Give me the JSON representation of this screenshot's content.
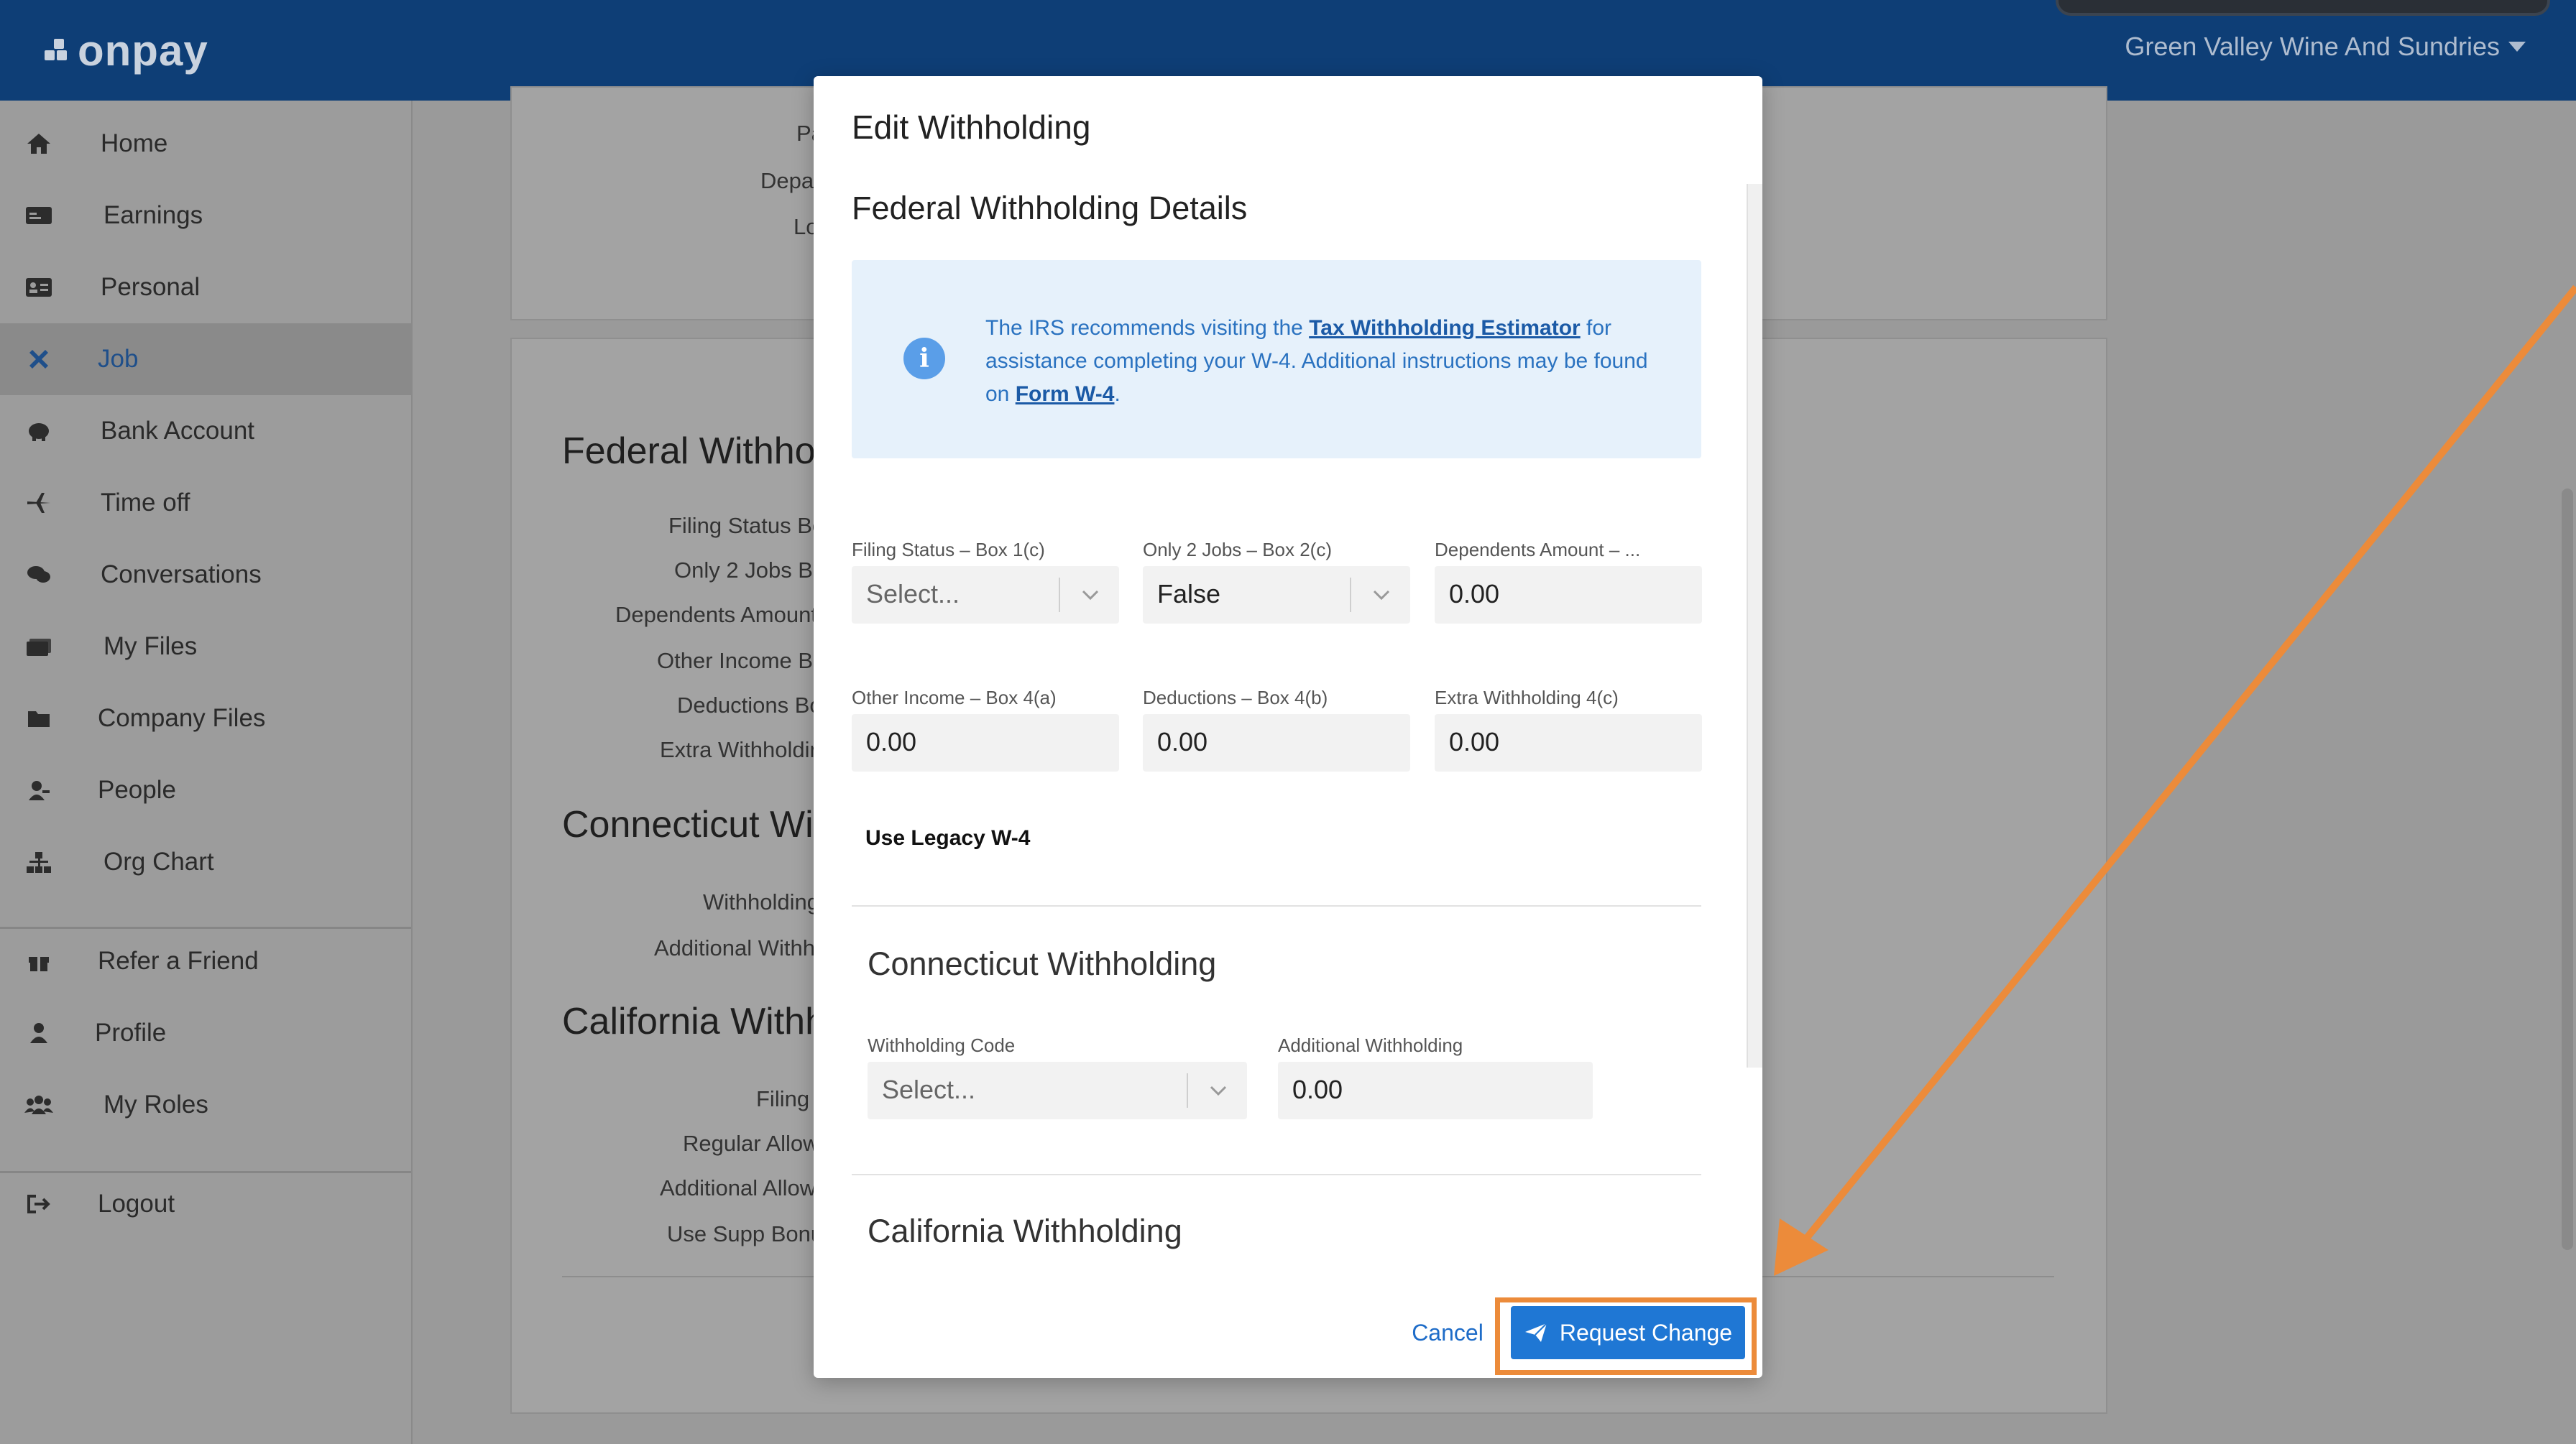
{
  "app": {
    "logo_text": "onpay",
    "company_name": "Green Valley Wine And Sundries"
  },
  "sidebar": {
    "items": [
      {
        "label": "Home",
        "icon": "home-icon"
      },
      {
        "label": "Earnings",
        "icon": "money-icon"
      },
      {
        "label": "Personal",
        "icon": "id-card-icon"
      },
      {
        "label": "Job",
        "icon": "tools-icon",
        "active": true
      },
      {
        "label": "Bank Account",
        "icon": "piggy-bank-icon"
      },
      {
        "label": "Time off",
        "icon": "plane-icon"
      },
      {
        "label": "Conversations",
        "icon": "chat-icon"
      },
      {
        "label": "My Files",
        "icon": "files-icon"
      },
      {
        "label": "Company Files",
        "icon": "folder-icon"
      },
      {
        "label": "People",
        "icon": "people-icon"
      },
      {
        "label": "Org Chart",
        "icon": "org-chart-icon"
      },
      {
        "label": "Refer a Friend",
        "icon": "gift-icon"
      },
      {
        "label": "Profile",
        "icon": "user-icon"
      },
      {
        "label": "My Roles",
        "icon": "group-icon"
      },
      {
        "label": "Logout",
        "icon": "logout-icon"
      }
    ]
  },
  "background": {
    "top_card_labels": [
      "Pa",
      "Depa",
      "Lo"
    ],
    "federal_heading": "Federal Withho",
    "federal_labels": [
      "Filing Status Bo",
      "Only 2 Jobs Bo",
      "Dependents Amount",
      "Other Income Bo",
      "Deductions Bo",
      "Extra Withholdin"
    ],
    "ct_heading": "Connecticut Wi",
    "ct_labels": [
      "Withholding",
      "Additional Withh"
    ],
    "ca_heading": "California Withh",
    "ca_labels": [
      "Filing",
      "Regular Allow",
      "Additional Allow",
      "Use Supp Bonu"
    ]
  },
  "modal": {
    "title": "Edit Withholding",
    "federal": {
      "title": "Federal Withholding Details",
      "info": {
        "text_1": "The IRS recommends visiting the ",
        "link_1": "Tax Withholding Estimator",
        "text_2": " for assistance completing your W-4. Additional instructions may be found on ",
        "link_2": "Form W-4",
        "text_3": "."
      },
      "fields": {
        "filing_status_label": "Filing Status – Box 1(c)",
        "filing_status_placeholder": "Select...",
        "two_jobs_label": "Only 2 Jobs – Box 2(c)",
        "two_jobs_value": "False",
        "dependents_label": "Dependents Amount – ...",
        "dependents_value": "0.00",
        "other_income_label": "Other Income – Box 4(a)",
        "other_income_value": "0.00",
        "deductions_label": "Deductions – Box 4(b)",
        "deductions_value": "0.00",
        "extra_withholding_label": "Extra Withholding 4(c)",
        "extra_withholding_value": "0.00"
      },
      "legacy_label": "Use Legacy W-4"
    },
    "connecticut": {
      "title": "Connecticut Withholding",
      "code_label": "Withholding Code",
      "code_placeholder": "Select...",
      "additional_label": "Additional Withholding",
      "additional_value": "0.00"
    },
    "california": {
      "title": "California Withholding"
    },
    "buttons": {
      "cancel": "Cancel",
      "request": "Request Change"
    }
  },
  "annotation": {
    "highlight_color": "#ec8b3a"
  }
}
